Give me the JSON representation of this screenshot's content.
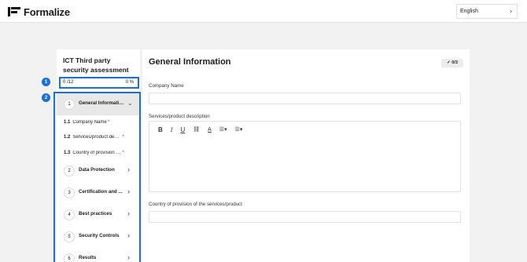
{
  "app": {
    "name": "Formalize"
  },
  "header": {
    "language": "English"
  },
  "sidebar": {
    "title": "ICT Third party security assessment",
    "progress": {
      "answered": "0 /12",
      "percent": "0 %"
    },
    "sections": [
      {
        "number": "1",
        "label": "General Informatio...",
        "expanded": true
      },
      {
        "number": "2",
        "label": "Data Protection"
      },
      {
        "number": "3",
        "label": "Certification and ..."
      },
      {
        "number": "4",
        "label": "Best practices"
      },
      {
        "number": "5",
        "label": "Security Controls"
      },
      {
        "number": "6",
        "label": "Results"
      }
    ],
    "subitems": [
      {
        "number": "1.1",
        "label": "Company Name",
        "required": "*"
      },
      {
        "number": "1.2",
        "label": "Services/product descri...",
        "required": "*"
      },
      {
        "number": "1.3",
        "label": "Country of provision of ...",
        "required": "*"
      }
    ]
  },
  "annotations": {
    "badge1": "1",
    "badge2": "2"
  },
  "main": {
    "title": "General Information",
    "status": "✓ 0/3",
    "fields": {
      "company_name": "Company Name",
      "services": "Services/product description",
      "country": "Country of provision of the services/product"
    }
  },
  "colors": {
    "highlight": "#1a6fe0",
    "required": "#dd1111",
    "background": "#f2f2f2"
  }
}
